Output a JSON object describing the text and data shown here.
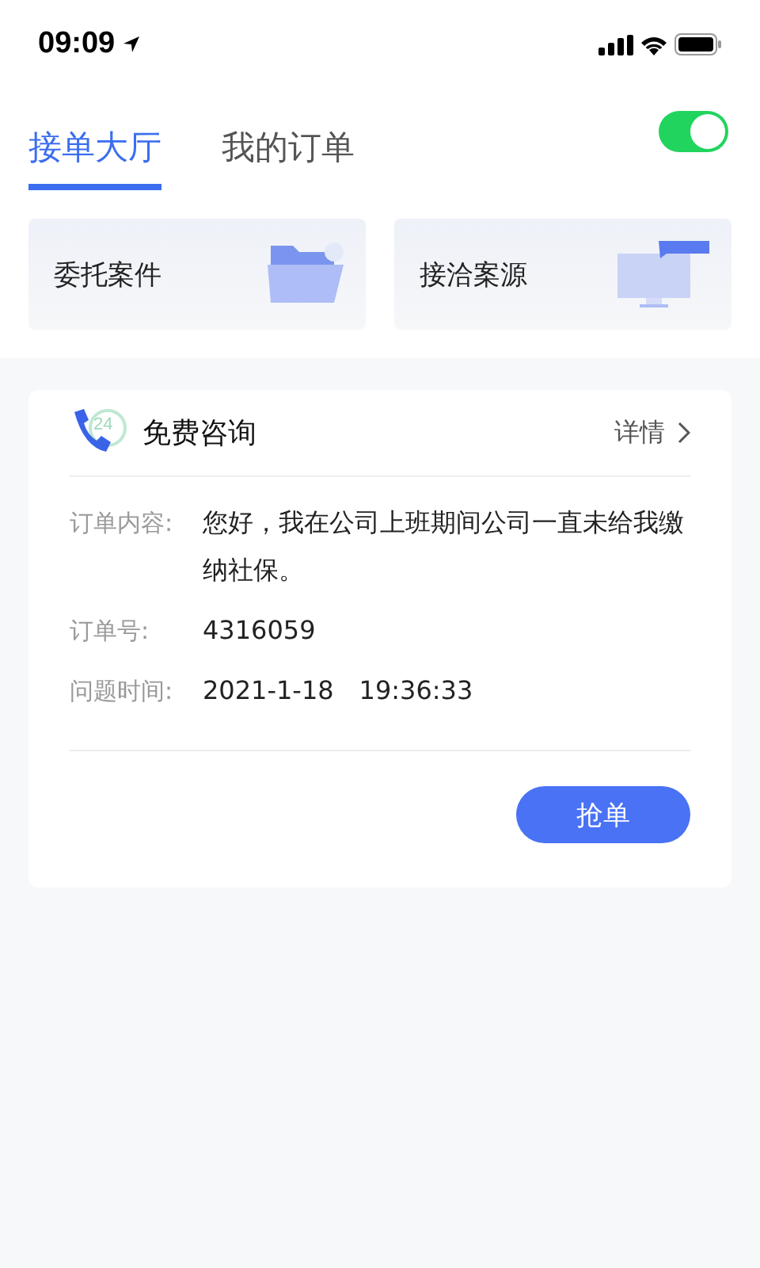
{
  "status_bar": {
    "time": "09:09"
  },
  "tabs": [
    {
      "label": "接单大厅",
      "selected": true
    },
    {
      "label": "我的订单",
      "selected": false
    }
  ],
  "toggle": {
    "on": true
  },
  "shortcuts": [
    {
      "label": "委托案件",
      "kind": "folder"
    },
    {
      "label": "接洽案源",
      "kind": "monitor"
    }
  ],
  "order_card": {
    "badge": "24",
    "title": "免费咨询",
    "detail_link": "详情",
    "fields": [
      {
        "label": "订单内容:",
        "value": "您好，我在公司上班期间公司一直未给我缴纳社保。"
      },
      {
        "label": "订单号:",
        "value": "4316059"
      },
      {
        "label": "问题时间:",
        "value": "2021-1-18　19:36:33"
      }
    ],
    "button": "抢单"
  }
}
